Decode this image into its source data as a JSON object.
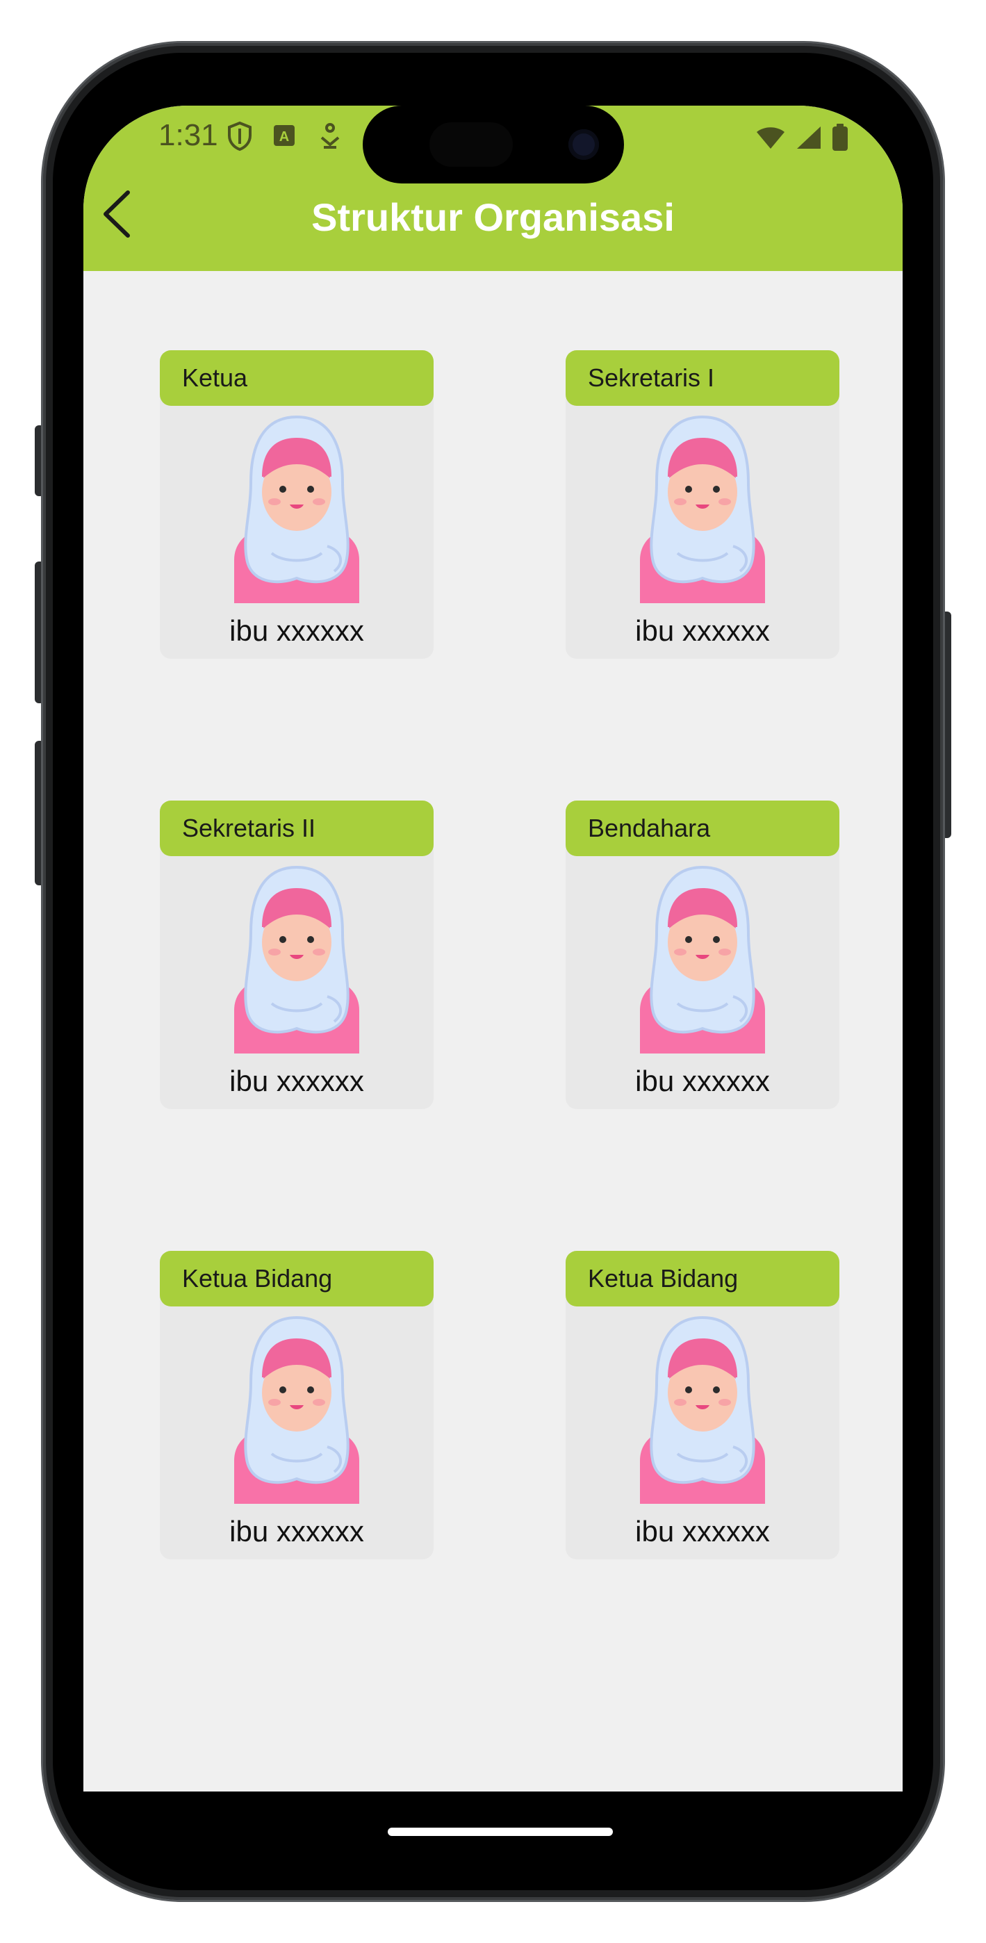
{
  "status_bar": {
    "time": "1:31",
    "left_icons": [
      "shield-icon",
      "a-badge-icon",
      "download-icon"
    ],
    "right_icons": [
      "wifi-icon",
      "signal-icon",
      "battery-icon"
    ]
  },
  "header": {
    "title": "Struktur Organisasi",
    "back_icon": "chevron-left-icon",
    "color": "#a8cf3c"
  },
  "members": [
    {
      "role": "Ketua",
      "name": "ibu xxxxxx"
    },
    {
      "role": "Sekretaris I",
      "name": "ibu xxxxxx"
    },
    {
      "role": "Sekretaris II",
      "name": "ibu xxxxxx"
    },
    {
      "role": "Bendahara",
      "name": "ibu xxxxxx"
    },
    {
      "role": "Ketua Bidang",
      "name": "ibu xxxxxx"
    },
    {
      "role": "Ketua Bidang",
      "name": "ibu xxxxxx"
    }
  ],
  "avatar_icon": "hijab-woman-avatar-icon",
  "colors": {
    "accent": "#a8cf3c",
    "background": "#f0f0f0",
    "card": "#e8e8e8"
  }
}
